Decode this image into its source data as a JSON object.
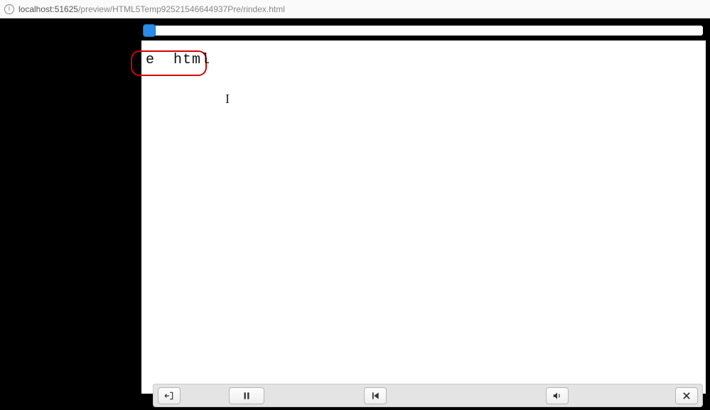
{
  "browser": {
    "url_host": "localhost:",
    "url_port": "51625",
    "url_path": "/preview/HTML5Temp92521546644937Pre/rindex.html"
  },
  "stage": {
    "visible_text": "e  html",
    "cursor_glyph": "I"
  },
  "controls": {
    "exit_label": "Exit",
    "pause_label": "Pause",
    "rewind_label": "Rewind",
    "volume_label": "Volume",
    "close_label": "Close"
  },
  "icons": {
    "info": "i"
  }
}
